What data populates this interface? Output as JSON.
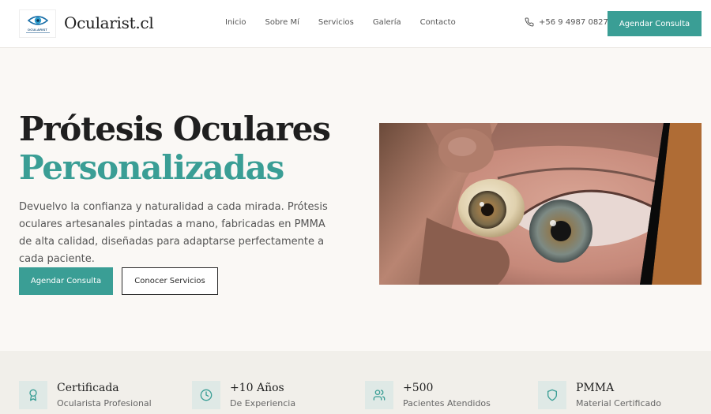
{
  "header": {
    "brand": "Ocularist.cl",
    "logo_text": "OCULARIST",
    "nav": [
      "Inicio",
      "Sobre Mí",
      "Servicios",
      "Galería",
      "Contacto"
    ],
    "phone": "+56 9 4987 0827",
    "cta": "Agendar Consulta"
  },
  "hero": {
    "title_line1": "Prótesis Oculares",
    "title_line2": "Personalizadas",
    "description": "Devuelvo la confianza y naturalidad a cada mirada. Prótesis oculares artesanales pintadas a mano, fabricadas en PMMA de alta calidad, diseñadas para adaptarse perfectamente a cada paciente.",
    "primary_button": "Agendar Consulta",
    "secondary_button": "Conocer Servicios"
  },
  "stats": [
    {
      "icon": "award-icon",
      "title": "Certificada",
      "subtitle": "Ocularista Profesional"
    },
    {
      "icon": "clock-icon",
      "title": "+10 Años",
      "subtitle": "De Experiencia"
    },
    {
      "icon": "users-icon",
      "title": "+500",
      "subtitle": "Pacientes Atendidos"
    },
    {
      "icon": "shield-icon",
      "title": "PMMA",
      "subtitle": "Material Certificado"
    }
  ],
  "colors": {
    "accent": "#3a9e95",
    "background": "#faf8f5",
    "stats_background": "#f1efea",
    "text": "#1f1f1f"
  }
}
